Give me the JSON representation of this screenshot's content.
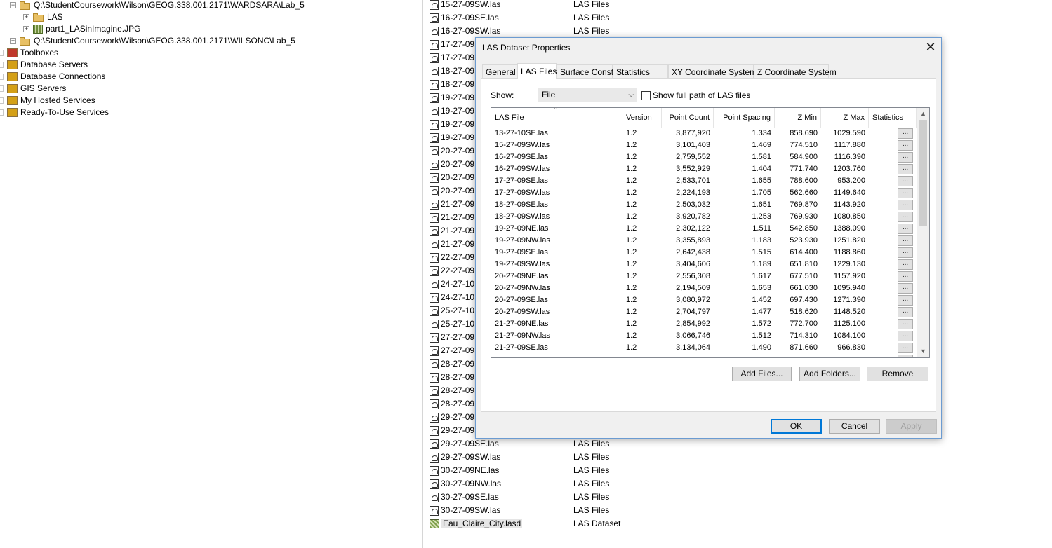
{
  "tree": {
    "items": [
      {
        "label": "Q:\\StudentCoursework\\Wilson\\GEOG.338.001.2171\\WARDSARA\\Lab_5",
        "expander": "−",
        "icon": "folder-icon"
      },
      {
        "label": "LAS",
        "expander": "+",
        "icon": "folder-open-icon"
      },
      {
        "label": "part1_LASinImagine.JPG",
        "expander": "+",
        "icon": "raster-icon"
      },
      {
        "label": "Q:\\StudentCoursework\\Wilson\\GEOG.338.001.2171\\WILSONC\\Lab_5",
        "expander": "+",
        "icon": "folder-icon"
      },
      {
        "label": "Toolboxes",
        "icon": "toolbox-icon"
      },
      {
        "label": "Database Servers",
        "icon": "database-server-icon"
      },
      {
        "label": "Database Connections",
        "icon": "database-connection-icon"
      },
      {
        "label": "GIS Servers",
        "icon": "gis-server-icon"
      },
      {
        "label": "My Hosted Services",
        "icon": "hosted-services-icon"
      },
      {
        "label": "Ready-To-Use Services",
        "icon": "ready-services-icon"
      }
    ]
  },
  "contents": {
    "rows": [
      {
        "name": "15-27-09SW.las",
        "type": "LAS Files"
      },
      {
        "name": "16-27-09SE.las",
        "type": "LAS Files"
      },
      {
        "name": "16-27-09SW.las",
        "type": "LAS Files"
      },
      {
        "name": "17-27-09",
        "type": ""
      },
      {
        "name": "17-27-09",
        "type": ""
      },
      {
        "name": "18-27-09",
        "type": ""
      },
      {
        "name": "18-27-09",
        "type": ""
      },
      {
        "name": "19-27-09",
        "type": ""
      },
      {
        "name": "19-27-09",
        "type": ""
      },
      {
        "name": "19-27-09",
        "type": ""
      },
      {
        "name": "19-27-09",
        "type": ""
      },
      {
        "name": "20-27-09",
        "type": ""
      },
      {
        "name": "20-27-09",
        "type": ""
      },
      {
        "name": "20-27-09",
        "type": ""
      },
      {
        "name": "20-27-09",
        "type": ""
      },
      {
        "name": "21-27-09",
        "type": ""
      },
      {
        "name": "21-27-09",
        "type": ""
      },
      {
        "name": "21-27-09",
        "type": ""
      },
      {
        "name": "21-27-09",
        "type": ""
      },
      {
        "name": "22-27-09",
        "type": ""
      },
      {
        "name": "22-27-09",
        "type": ""
      },
      {
        "name": "24-27-10",
        "type": ""
      },
      {
        "name": "24-27-10",
        "type": ""
      },
      {
        "name": "25-27-10",
        "type": ""
      },
      {
        "name": "25-27-10",
        "type": ""
      },
      {
        "name": "27-27-09",
        "type": ""
      },
      {
        "name": "27-27-09",
        "type": ""
      },
      {
        "name": "28-27-09",
        "type": ""
      },
      {
        "name": "28-27-09",
        "type": ""
      },
      {
        "name": "28-27-09",
        "type": ""
      },
      {
        "name": "28-27-09",
        "type": ""
      },
      {
        "name": "29-27-09",
        "type": ""
      },
      {
        "name": "29-27-09",
        "type": ""
      },
      {
        "name": "29-27-09SE.las",
        "type": "LAS Files"
      },
      {
        "name": "29-27-09SW.las",
        "type": "LAS Files"
      },
      {
        "name": "30-27-09NE.las",
        "type": "LAS Files"
      },
      {
        "name": "30-27-09NW.las",
        "type": "LAS Files"
      },
      {
        "name": "30-27-09SE.las",
        "type": "LAS Files"
      },
      {
        "name": "30-27-09SW.las",
        "type": "LAS Files"
      },
      {
        "name": "Eau_Claire_City.lasd",
        "type": "LAS Dataset",
        "dataset": true
      }
    ]
  },
  "dialog": {
    "title": "LAS Dataset Properties",
    "close": "✕",
    "tabs": [
      "General",
      "LAS Files",
      "Surface Constraints",
      "Statistics",
      "XY Coordinate System",
      "Z Coordinate System"
    ],
    "active_tab": "LAS Files",
    "show_label": "Show:",
    "show_value": "File",
    "fullpath_label": "Show full path of LAS files",
    "columns": [
      "LAS File",
      "Version",
      "Point Count",
      "Point Spacing",
      "Z Min",
      "Z Max",
      "Statistics"
    ],
    "rows": [
      [
        "13-27-10SE.las",
        "1.2",
        "3,877,920",
        "1.334",
        "858.690",
        "1029.590"
      ],
      [
        "15-27-09SW.las",
        "1.2",
        "3,101,403",
        "1.469",
        "774.510",
        "1117.880"
      ],
      [
        "16-27-09SE.las",
        "1.2",
        "2,759,552",
        "1.581",
        "584.900",
        "1116.390"
      ],
      [
        "16-27-09SW.las",
        "1.2",
        "3,552,929",
        "1.404",
        "771.740",
        "1203.760"
      ],
      [
        "17-27-09SE.las",
        "1.2",
        "2,533,701",
        "1.655",
        "788.600",
        "953.200"
      ],
      [
        "17-27-09SW.las",
        "1.2",
        "2,224,193",
        "1.705",
        "562.660",
        "1149.640"
      ],
      [
        "18-27-09SE.las",
        "1.2",
        "2,503,032",
        "1.651",
        "769.870",
        "1143.920"
      ],
      [
        "18-27-09SW.las",
        "1.2",
        "3,920,782",
        "1.253",
        "769.930",
        "1080.850"
      ],
      [
        "19-27-09NE.las",
        "1.2",
        "2,302,122",
        "1.511",
        "542.850",
        "1388.090"
      ],
      [
        "19-27-09NW.las",
        "1.2",
        "3,355,893",
        "1.183",
        "523.930",
        "1251.820"
      ],
      [
        "19-27-09SE.las",
        "1.2",
        "2,642,438",
        "1.515",
        "614.400",
        "1188.860"
      ],
      [
        "19-27-09SW.las",
        "1.2",
        "3,404,606",
        "1.189",
        "651.810",
        "1229.130"
      ],
      [
        "20-27-09NE.las",
        "1.2",
        "2,556,308",
        "1.617",
        "677.510",
        "1157.920"
      ],
      [
        "20-27-09NW.las",
        "1.2",
        "2,194,509",
        "1.653",
        "661.030",
        "1095.940"
      ],
      [
        "20-27-09SE.las",
        "1.2",
        "3,080,972",
        "1.452",
        "697.430",
        "1271.390"
      ],
      [
        "20-27-09SW.las",
        "1.2",
        "2,704,797",
        "1.477",
        "518.620",
        "1148.520"
      ],
      [
        "21-27-09NE.las",
        "1.2",
        "2,854,992",
        "1.572",
        "772.700",
        "1125.100"
      ],
      [
        "21-27-09NW.las",
        "1.2",
        "3,066,746",
        "1.512",
        "714.310",
        "1084.100"
      ],
      [
        "21-27-09SE.las",
        "1.2",
        "3,134,064",
        "1.490",
        "871.660",
        "966.830"
      ]
    ],
    "stat_button": "...",
    "buttons": {
      "add_files": "Add Files...",
      "add_folders": "Add Folders...",
      "remove": "Remove",
      "ok": "OK",
      "cancel": "Cancel",
      "apply": "Apply"
    }
  }
}
